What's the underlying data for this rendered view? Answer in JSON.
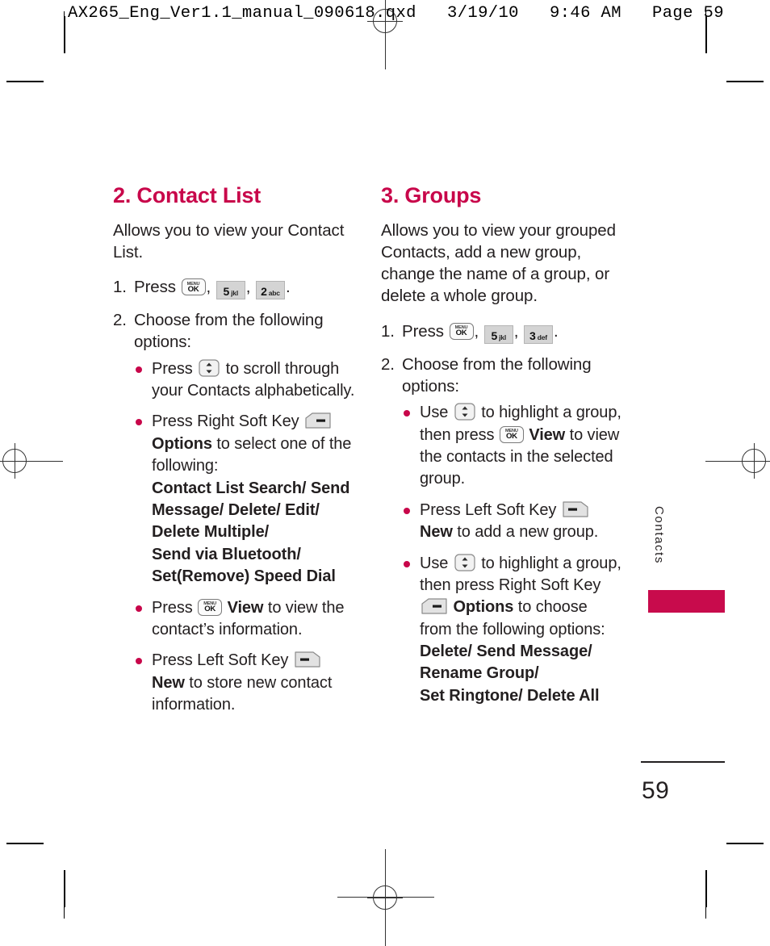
{
  "print_header": {
    "text": "AX265_Eng_Ver1.1_manual_090618.qxd   3/19/10   9:46 AM   Page 59"
  },
  "colors": {
    "accent": "#c8064a",
    "tab_block": "#c80b4c",
    "text": "#231f20"
  },
  "side_tab": {
    "label": "Contacts"
  },
  "footer": {
    "page_number": "59"
  },
  "left_column": {
    "title": "2. Contact List",
    "intro": "Allows you to view your Contact List.",
    "step1": {
      "num": "1.",
      "press_label": "Press",
      "keys": [
        {
          "icon": "menu-ok-key",
          "menu": "MENU",
          "ok": "OK"
        },
        {
          "icon": "numeric-key",
          "digit": "5",
          "letters": "jkl"
        },
        {
          "icon": "numeric-key",
          "digit": "2",
          "letters": "abc"
        }
      ],
      "separator": ",",
      "period": "."
    },
    "step2": {
      "num": "2.",
      "text": "Choose from the following options:"
    },
    "bullets": [
      {
        "pre": "Press",
        "icon": "nav-updown-key",
        "post": "to scroll through your Contacts alphabetically."
      },
      {
        "pre": "Press Right Soft Key",
        "icon": "right-soft-key",
        "bold": "Options",
        "post": "to select one of the following:"
      },
      {
        "pre": "Press",
        "icon": "menu-ok-key",
        "bold": "View",
        "post": "to view the contact’s information."
      },
      {
        "pre": "Press Left Soft Key",
        "icon": "left-soft-key",
        "bold": "New",
        "post": "to store new contact information."
      }
    ],
    "options_block": [
      "Contact List Search/ Send",
      "Message/ Delete/ Edit/",
      "Delete Multiple/",
      "Send via Bluetooth/",
      "Set(Remove) Speed Dial"
    ]
  },
  "right_column": {
    "title": "3. Groups",
    "intro": "Allows you to view your grouped Contacts, add a new group, change the name of a group, or delete a whole group.",
    "step1": {
      "num": "1.",
      "press_label": "Press",
      "keys": [
        {
          "icon": "menu-ok-key",
          "menu": "MENU",
          "ok": "OK"
        },
        {
          "icon": "numeric-key",
          "digit": "5",
          "letters": "jkl"
        },
        {
          "icon": "numeric-key",
          "digit": "3",
          "letters": "def"
        }
      ],
      "separator": ",",
      "period": "."
    },
    "step2": {
      "num": "2.",
      "text": "Choose from the following options:"
    },
    "bullets": [
      {
        "pre": "Use",
        "icon": "nav-updown-key",
        "mid": "to highlight a group, then press",
        "icon2": "menu-ok-key",
        "bold": "View",
        "post": "to view the contacts in the selected group."
      },
      {
        "pre": "Press Left Soft Key",
        "icon": "left-soft-key",
        "bold": "New",
        "post": "to add a new group."
      },
      {
        "pre": "Use",
        "icon": "nav-updown-key",
        "mid": "to highlight a group, then press Right Soft Key",
        "icon2": "right-soft-key",
        "bold": "Options",
        "post": "to choose from the following options:"
      }
    ],
    "options_block": [
      "Delete/ Send Message/",
      "Rename Group/",
      "Set Ringtone/ Delete All"
    ]
  }
}
